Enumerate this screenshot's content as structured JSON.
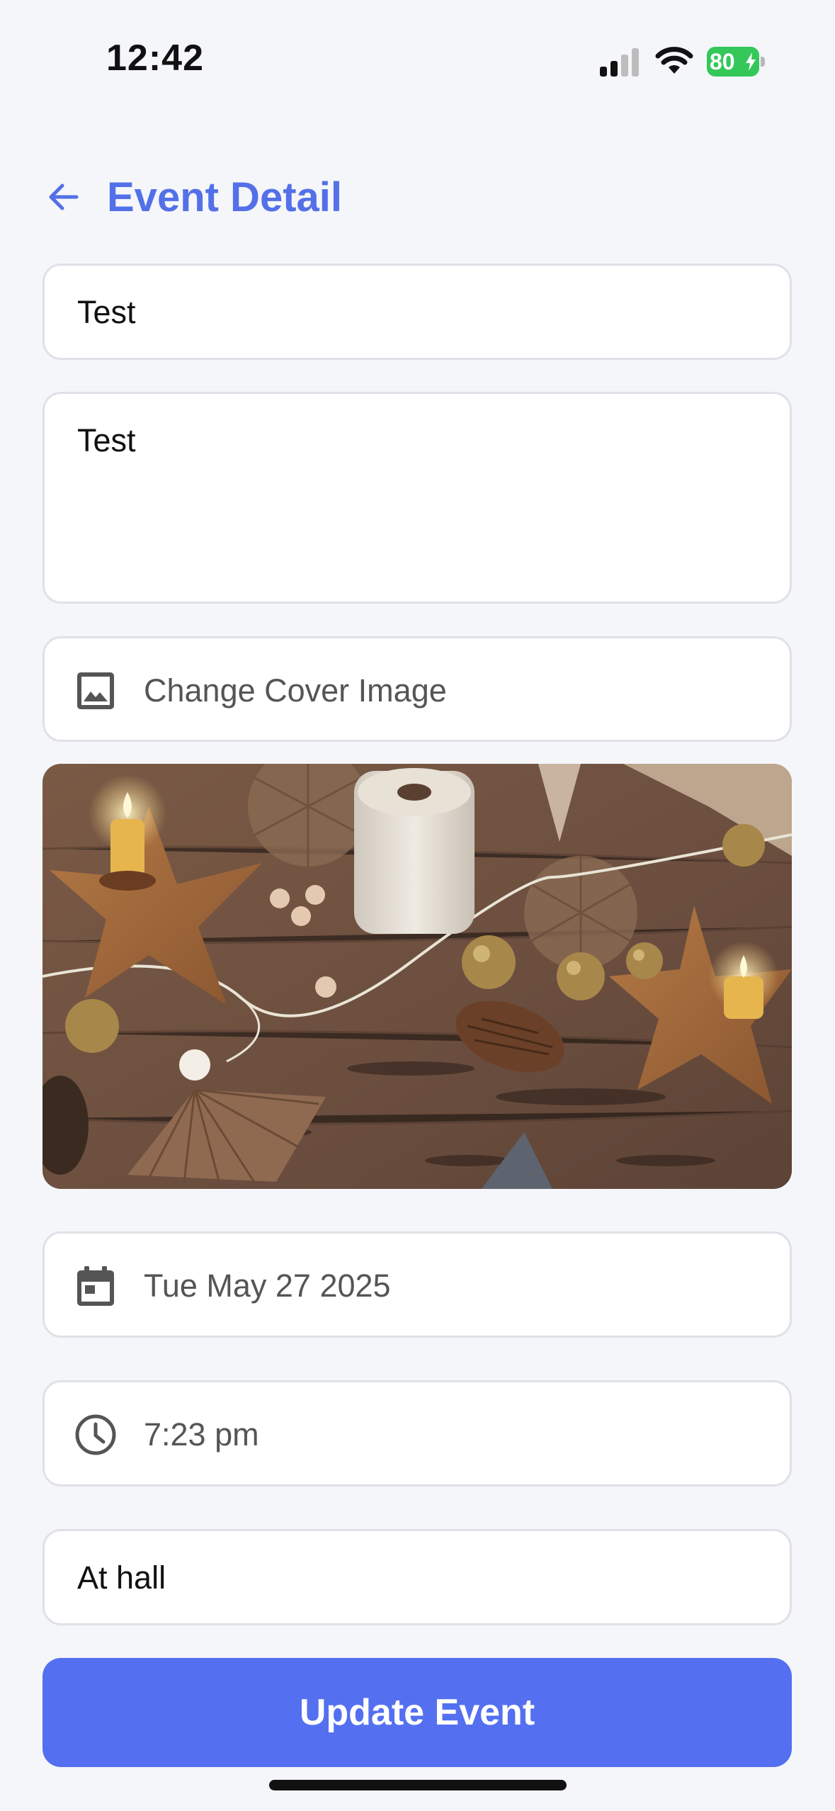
{
  "status_bar": {
    "time": "12:42",
    "battery_percent": "80",
    "icons": [
      "cellular-signal-icon",
      "wifi-icon",
      "battery-charging-icon"
    ]
  },
  "header": {
    "back_icon": "arrow-left-icon",
    "title": "Event Detail"
  },
  "form": {
    "title_value": "Test",
    "description_value": "Test",
    "cover": {
      "icon": "image-icon",
      "label": "Change Cover Image"
    },
    "date": {
      "icon": "calendar-icon",
      "value": "Tue May 27 2025"
    },
    "time": {
      "icon": "clock-icon",
      "value": "7:23 pm"
    },
    "location_value": "At hall"
  },
  "actions": {
    "update_label": "Update Event"
  },
  "colors": {
    "accent": "#5470E8",
    "button": "#5470F0",
    "background": "#F5F6FA",
    "battery": "#34C759"
  }
}
